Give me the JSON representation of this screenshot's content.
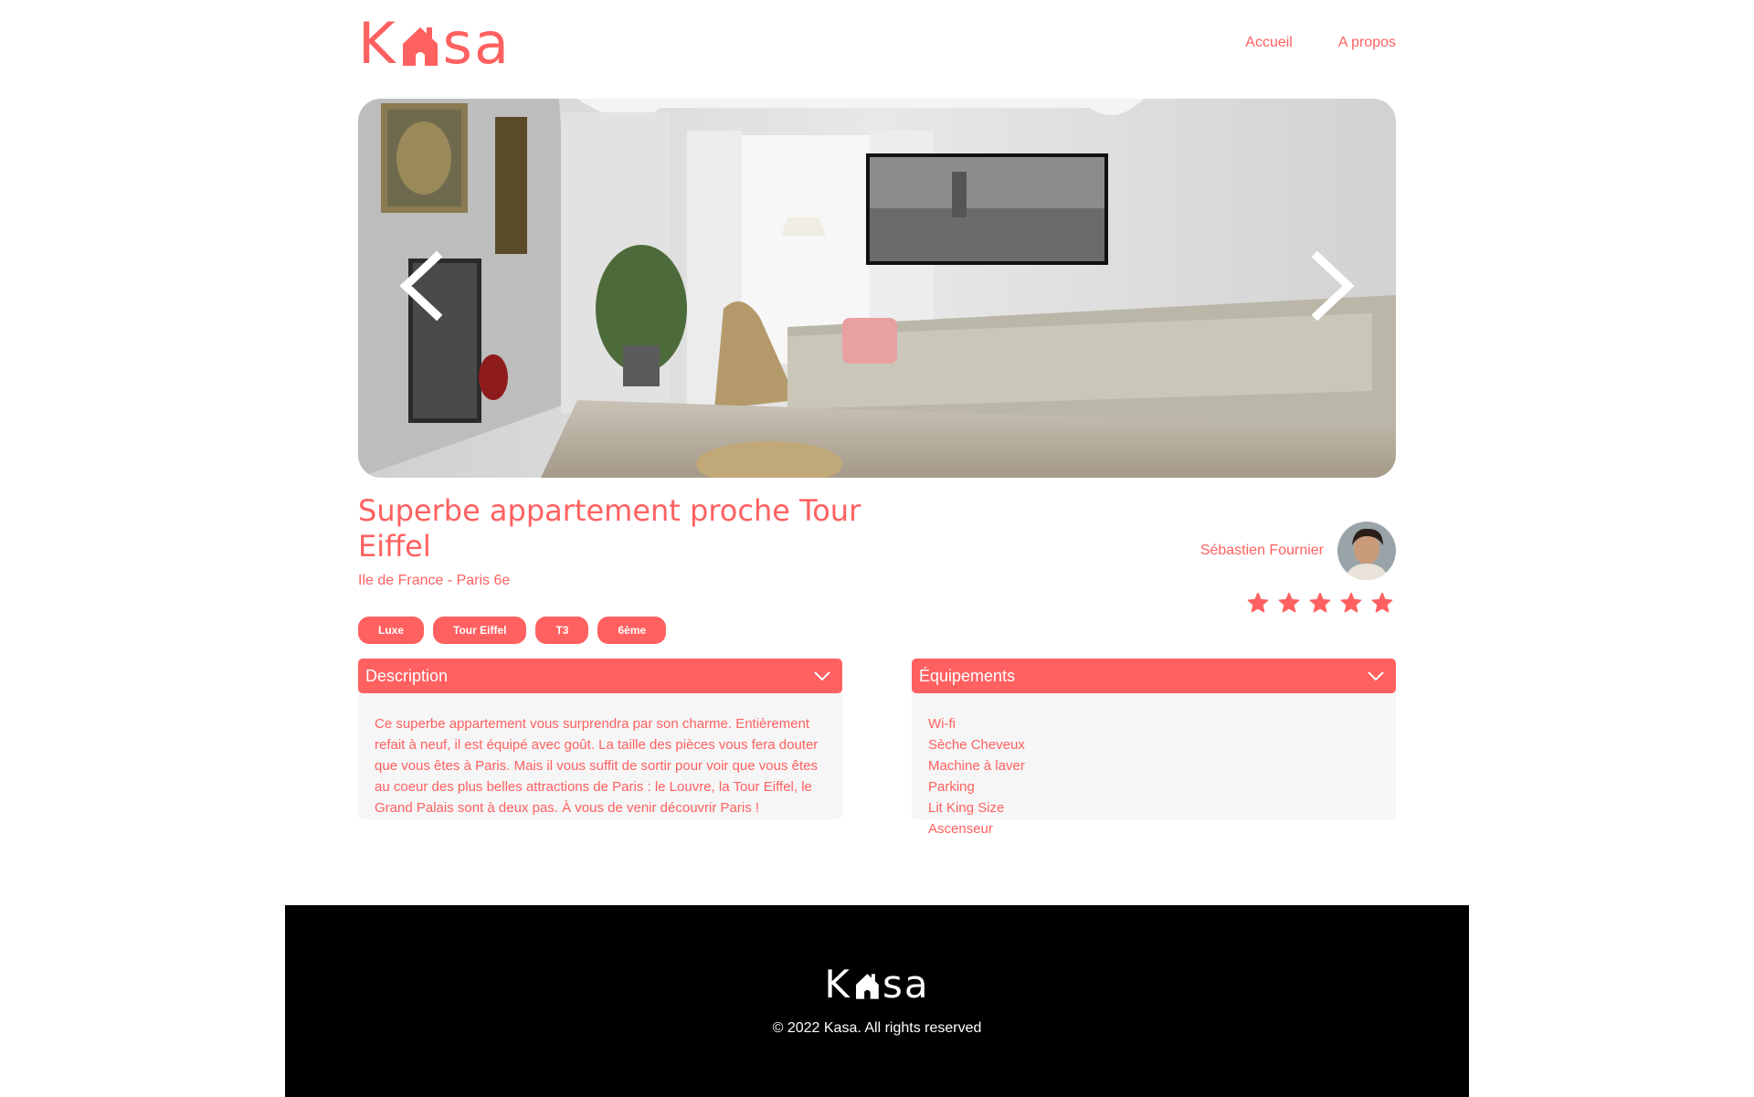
{
  "brand": {
    "logo_left": "K",
    "logo_right": "sa",
    "accent_color": "#ff6060"
  },
  "nav": {
    "items": [
      {
        "label": "Accueil"
      },
      {
        "label": "A propos"
      }
    ]
  },
  "carousel": {
    "prev_icon": "chevron-left-icon",
    "next_icon": "chevron-right-icon"
  },
  "listing": {
    "title": "Superbe appartement proche Tour Eiffel",
    "location": "Ile de France - Paris 6e",
    "tags": [
      "Luxe",
      "Tour Eiffel",
      "T3",
      "6ème"
    ],
    "rating": 5,
    "rating_max": 5
  },
  "host": {
    "name": "Sébastien Fournier"
  },
  "description": {
    "label": "Description",
    "text": "Ce superbe appartement vous surprendra par son charme. Entièrement refait à neuf, il est équipé avec goût. La taille des pièces vous fera douter que vous êtes à Paris. Mais il vous suffit de sortir pour voir que vous êtes au coeur des plus belles attractions de Paris : le Louvre, la Tour Eiffel, le Grand Palais sont à deux pas. À vous de venir découvrir Paris !"
  },
  "equipments": {
    "label": "Équipements",
    "items": [
      "Wi-fi",
      "Sèche Cheveux",
      "Machine à laver",
      "Parking",
      "Lit King Size",
      "Ascenseur"
    ]
  },
  "footer": {
    "logo_left": "K",
    "logo_right": "sa",
    "copyright": "© 2022 Kasa. All rights reserved"
  }
}
